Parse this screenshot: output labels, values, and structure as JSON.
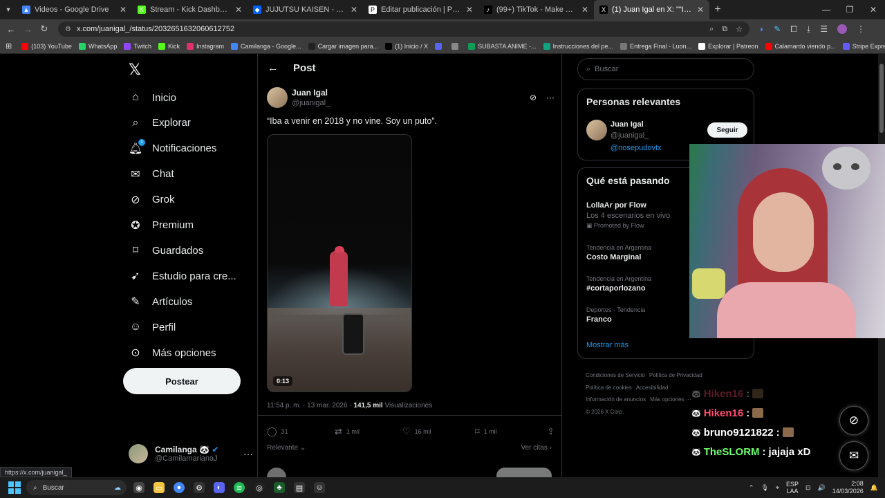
{
  "browser": {
    "tabs": [
      {
        "title": "Videos - Google Drive",
        "color": "#4285f4",
        "glyph": "▲"
      },
      {
        "title": "Stream - Kick Dashboard",
        "color": "#53fc18",
        "glyph": "K"
      },
      {
        "title": "JUJUTSU KAISEN - Dropbox",
        "color": "#0061fe",
        "glyph": "◆"
      },
      {
        "title": "Editar publicación | Patreon",
        "color": "#ffffff",
        "glyph": "P"
      },
      {
        "title": "(99+) TikTok - Make Your Day",
        "color": "#000000",
        "glyph": "♪"
      },
      {
        "title": "(1) Juan Igal en X: \"\"Iba a venir",
        "color": "#000000",
        "glyph": "X"
      }
    ],
    "url": "x.com/juanigal_/status/2032651632060612752",
    "bookmarks": [
      {
        "label": "(103) YouTube",
        "color": "#ff0000"
      },
      {
        "label": "WhatsApp",
        "color": "#25d366"
      },
      {
        "label": "Twitch",
        "color": "#9146ff"
      },
      {
        "label": "Kick",
        "color": "#53fc18"
      },
      {
        "label": "Instagram",
        "color": "#e1306c"
      },
      {
        "label": "Camilanga - Google...",
        "color": "#4285f4"
      },
      {
        "label": "Cargar imagen para...",
        "color": "#222222"
      },
      {
        "label": "(1) Inicio / X",
        "color": "#000000"
      },
      {
        "label": "",
        "color": "#5865f2"
      },
      {
        "label": "",
        "color": "#888888"
      },
      {
        "label": "SUBASTA ANIME -...",
        "color": "#0f9d58"
      },
      {
        "label": "Instrucciones del pe...",
        "color": "#10a37f"
      },
      {
        "label": "Entrega Final - Luon...",
        "color": "#777777"
      },
      {
        "label": "Explorar | Patreon",
        "color": "#ffffff"
      },
      {
        "label": "Calamardo viendo p...",
        "color": "#ff0000"
      },
      {
        "label": "Stripe Express",
        "color": "#635bff"
      }
    ],
    "status_url": "https://x.com/juanigal_"
  },
  "nav": {
    "items": [
      "Inicio",
      "Explorar",
      "Notificaciones",
      "Chat",
      "Grok",
      "Premium",
      "Guardados",
      "Estudio para cre...",
      "Artículos",
      "Perfil",
      "Más opciones"
    ],
    "icons": [
      "home-icon",
      "search-icon",
      "bell-icon",
      "mail-icon",
      "grok-icon",
      "premium-icon",
      "bookmark-icon",
      "rocket-icon",
      "article-icon",
      "person-icon",
      "more-circle-icon"
    ],
    "notif_count": "1",
    "post_button": "Postear",
    "account_name": "Camilanga 🐼",
    "account_handle": "@CamilamarianaJ"
  },
  "post": {
    "header": "Post",
    "author_name": "Juan Igal",
    "author_handle": "@juanigal_",
    "text": "“Iba a venir en 2018 y no vine. Soy un puto”.",
    "video_duration": "0:13",
    "timestamp": "11:54 p. m. · 13 mar. 2026 · ",
    "views_count": "141,5 mil",
    "views_label": " Visualizaciones",
    "replies": "31",
    "reposts": "1 mil",
    "likes": "16 mil",
    "bookmarks": "1 mil",
    "sort_label": "Relevante",
    "quotes_label": "Ver citas"
  },
  "sidebar": {
    "search_placeholder": "Buscar",
    "relevant_title": "Personas relevantes",
    "relevant_name": "Juan Igal",
    "relevant_handle": "@juanigal_",
    "relevant_link": "@nosepudovtx",
    "follow_label": "Seguir",
    "trending_title": "Qué está pasando",
    "trends": [
      {
        "context": "",
        "title": "LollaAr por Flow",
        "sub": "Los 4 escenarios en vivo",
        "promo": "Promoted by Flow"
      },
      {
        "context": "Tendencia en Argentina",
        "title": "Costo Marginal",
        "sub": "",
        "promo": ""
      },
      {
        "context": "Tendencia en Argentina",
        "title": "#cortaporlozano",
        "sub": "",
        "promo": ""
      },
      {
        "context": "Deportes · Tendencia",
        "title": "Franco",
        "sub": "",
        "promo": ""
      }
    ],
    "show_more": "Mostrar más",
    "footer": [
      "Condiciones de Servicio",
      "Política de Privacidad",
      "Política de cookies",
      "Accesibilidad",
      "Información de anuncios",
      "Más opciones ···",
      "© 2026 X Corp."
    ]
  },
  "stream_chat": [
    {
      "user": "Hiken16",
      "message": "",
      "color": "#ff4d6d",
      "faded": true
    },
    {
      "user": "Hiken16",
      "message": "",
      "color": "#ff4d6d",
      "faded": false
    },
    {
      "user": "bruno9121822",
      "message": "",
      "color": "#ffffff",
      "faded": false
    },
    {
      "user": "TheSLORM",
      "message": "jajaja xD",
      "color": "#6cff6c",
      "faded": false
    }
  ],
  "taskbar": {
    "search": "Buscar",
    "lang_top": "ESP",
    "lang_bottom": "LAA",
    "time": "2:08",
    "date": "14/03/2026"
  }
}
